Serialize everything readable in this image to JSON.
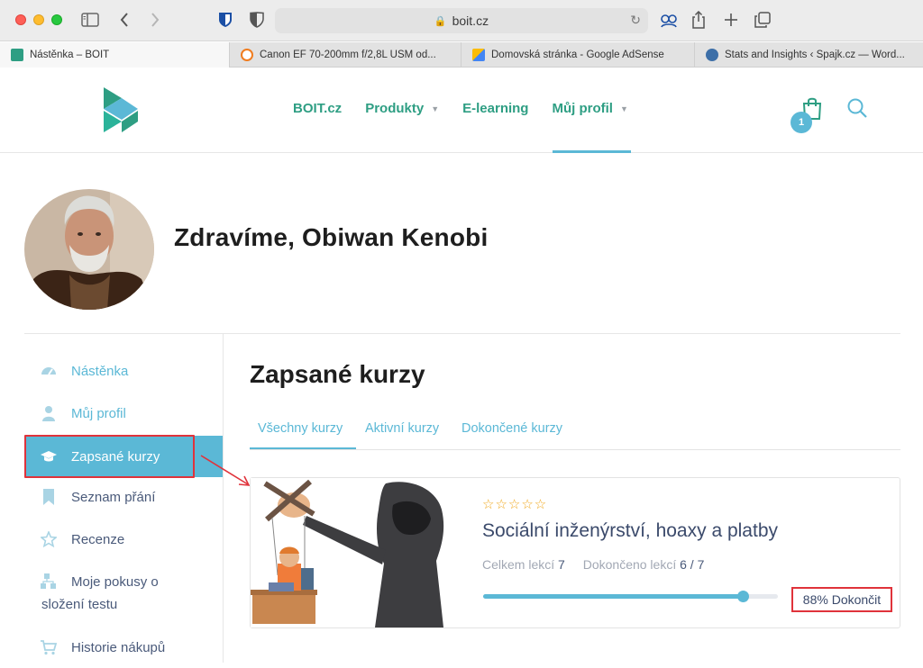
{
  "browser": {
    "url": "boit.cz",
    "tabs": [
      {
        "label": "Nástěnka – BOIT",
        "active": true,
        "favicon_color": "#2e9e83"
      },
      {
        "label": "Canon EF 70-200mm f/2,8L USM od...",
        "active": false,
        "favicon_color": "#f07c1e"
      },
      {
        "label": "Domovská stránka - Google AdSense",
        "active": false,
        "favicon_color": "#fbbc05"
      },
      {
        "label": "Stats and Insights ‹ Spajk.cz — Word...",
        "active": false,
        "favicon_color": "#3d6fa8"
      }
    ]
  },
  "header": {
    "nav": [
      {
        "label": "BOIT.cz",
        "has_dropdown": false
      },
      {
        "label": "Produkty",
        "has_dropdown": true
      },
      {
        "label": "E-learning",
        "has_dropdown": false
      },
      {
        "label": "Můj profil",
        "has_dropdown": true
      }
    ],
    "cart_count": "1",
    "accent": "#2e9e83",
    "highlight": "#5bb8d6"
  },
  "profile": {
    "greeting": "Zdravíme, Obiwan Kenobi"
  },
  "sidebar": {
    "items": [
      {
        "label": "Nástěnka",
        "icon": "dashboard-icon"
      },
      {
        "label": "Můj profil",
        "icon": "user-icon"
      },
      {
        "label": "Zapsané kurzy",
        "icon": "graduation-cap-icon",
        "active": true
      },
      {
        "label": "Seznam přání",
        "icon": "bookmark-icon"
      },
      {
        "label": "Recenze",
        "icon": "star-icon"
      },
      {
        "label": "Moje pokusy o",
        "label_line2": "složení testu",
        "icon": "quiz-attempts-icon"
      },
      {
        "label": "Historie nákupů",
        "icon": "cart-icon"
      }
    ]
  },
  "main": {
    "title": "Zapsané kurzy",
    "tabs": [
      {
        "label": "Všechny kurzy",
        "active": true
      },
      {
        "label": "Aktivní kurzy",
        "active": false
      },
      {
        "label": "Dokončené kurzy",
        "active": false
      }
    ],
    "course": {
      "rating_stars": "☆☆☆☆☆",
      "title": "Sociální inženýrství, hoaxy a platby",
      "total_label": "Celkem lekcí",
      "total_value": "7",
      "done_label": "Dokončeno lekcí",
      "done_value": "6 / 7",
      "progress_percent": 88,
      "progress_text": "88% Dokončit"
    }
  }
}
